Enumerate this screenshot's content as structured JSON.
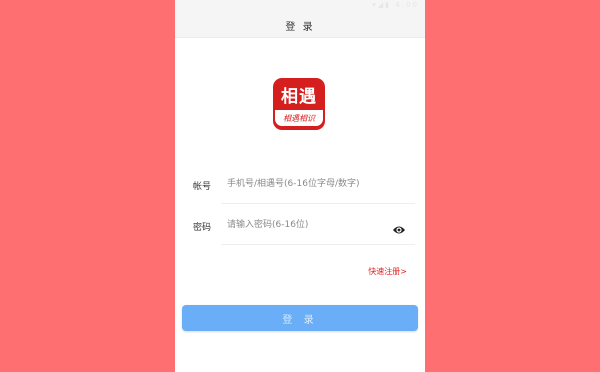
{
  "status_bar": {
    "icons": [
      "wifi-icon",
      "signal-icon",
      "battery-icon"
    ],
    "time": "4:00"
  },
  "header": {
    "title": "登 录"
  },
  "logo": {
    "name": "相遇",
    "slogan": "相遇相识",
    "brand_color": "#d51e1e"
  },
  "form": {
    "account_label": "帐号",
    "account_placeholder": "手机号/相遇号(6-16位字母/数字)",
    "account_value": "",
    "password_label": "密码",
    "password_placeholder": "请输入密码(6-16位)",
    "password_value": "",
    "password_toggle_icon": "eye-icon"
  },
  "register_link": "快速注册>",
  "login_button": "登 录",
  "colors": {
    "background": "#fe6f71",
    "link": "#e52121",
    "button": "#69aef6"
  }
}
